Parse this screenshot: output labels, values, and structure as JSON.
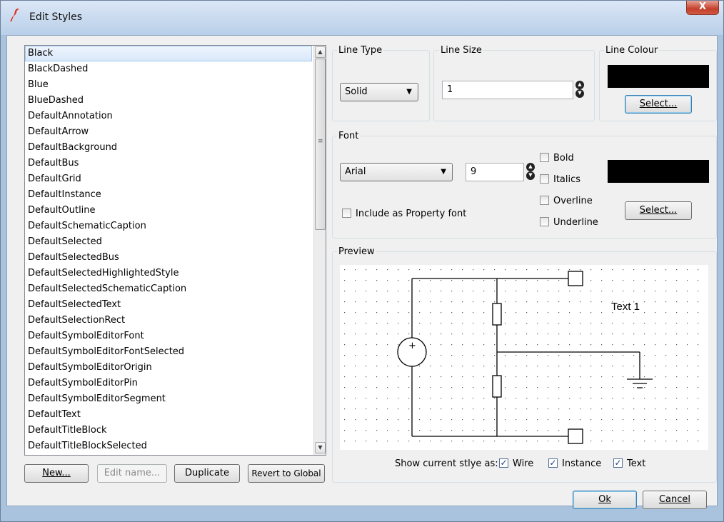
{
  "window": {
    "title": "Edit Styles",
    "close_label": "X"
  },
  "styles_list": {
    "selected": "Black",
    "items": [
      "Black",
      "BlackDashed",
      "Blue",
      "BlueDashed",
      "DefaultAnnotation",
      "DefaultArrow",
      "DefaultBackground",
      "DefaultBus",
      "DefaultGrid",
      "DefaultInstance",
      "DefaultOutline",
      "DefaultSchematicCaption",
      "DefaultSelected",
      "DefaultSelectedBus",
      "DefaultSelectedHighlightedStyle",
      "DefaultSelectedSchematicCaption",
      "DefaultSelectedText",
      "DefaultSelectionRect",
      "DefaultSymbolEditorFont",
      "DefaultSymbolEditorFontSelected",
      "DefaultSymbolEditorOrigin",
      "DefaultSymbolEditorPin",
      "DefaultSymbolEditorSegment",
      "DefaultText",
      "DefaultTitleBlock",
      "DefaultTitleBlockSelected"
    ]
  },
  "list_buttons": {
    "new_label": "New...",
    "edit_name_label": "Edit name...",
    "duplicate_label": "Duplicate",
    "revert_label": "Revert to Global"
  },
  "line_type": {
    "group_label": "Line Type",
    "value": "Solid"
  },
  "line_size": {
    "group_label": "Line Size",
    "value": "1"
  },
  "line_colour": {
    "group_label": "Line Colour",
    "color": "#000000",
    "select_label": "Select..."
  },
  "font": {
    "group_label": "Font",
    "family": "Arial",
    "size": "9",
    "bold_label": "Bold",
    "italics_label": "Italics",
    "overline_label": "Overline",
    "underline_label": "Underline",
    "include_label": "Include as Property font",
    "color": "#000000",
    "select_label": "Select..."
  },
  "preview": {
    "group_label": "Preview",
    "text_label": "Text 1",
    "show_as_label": "Show current stlye as:",
    "wire_label": "Wire",
    "instance_label": "Instance",
    "text_option_label": "Text"
  },
  "dialog_buttons": {
    "ok_label": "Ok",
    "cancel_label": "Cancel"
  }
}
